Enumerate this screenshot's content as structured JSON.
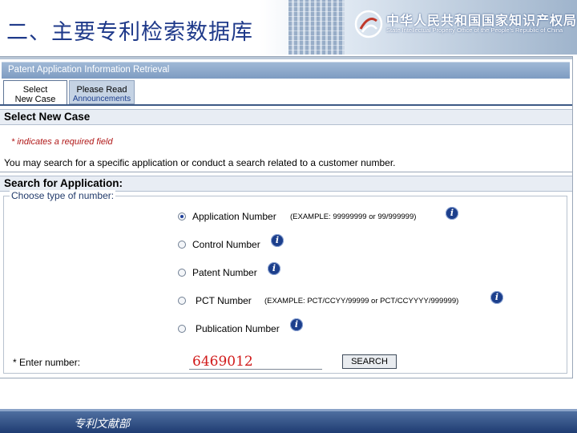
{
  "slide": {
    "title": "二、主要专利检索数据库",
    "org_name_cn": "中华人民共和国国家知识产权局",
    "org_name_en": "State Intellectual Property Office of the People's Republic of China",
    "footer": "专利文献部"
  },
  "app": {
    "title": "Patent Application Information Retrieval",
    "tabs": [
      {
        "line1": "Select",
        "line2": "New Case"
      },
      {
        "line1": "Please Read",
        "line2": "Announcements"
      }
    ],
    "select_section": {
      "heading": "Select New Case",
      "required_note": "* indicates a required field",
      "info": "You may search for a specific application or conduct a search related to a customer number."
    },
    "search_section": {
      "heading": "Search for Application:",
      "legend": "Choose type of number:",
      "options": [
        {
          "label": "Application Number",
          "example": "(EXAMPLE: 99999999 or 99/999999)",
          "selected": true
        },
        {
          "label": "Control Number",
          "example": "",
          "selected": false
        },
        {
          "label": "Patent Number",
          "example": "",
          "selected": false
        },
        {
          "label": "PCT Number",
          "example": "(EXAMPLE: PCT/CCYY/99999 or PCT/CCYYYY/999999)",
          "selected": false
        },
        {
          "label": "Publication Number",
          "example": "",
          "selected": false
        }
      ],
      "enter_label": "* Enter number:",
      "number_value": "6469012",
      "search_button": "SEARCH",
      "info_glyph": "i"
    }
  },
  "colors": {
    "title_blue": "#1f3a8a",
    "header_bar": "#8ca9cc",
    "required_red": "#b01818",
    "input_red": "#d11a1a",
    "info_icon": "#1c3f8c"
  },
  "icons": [
    "sipo-logo-icon",
    "info-icon",
    "radio-icon"
  ]
}
